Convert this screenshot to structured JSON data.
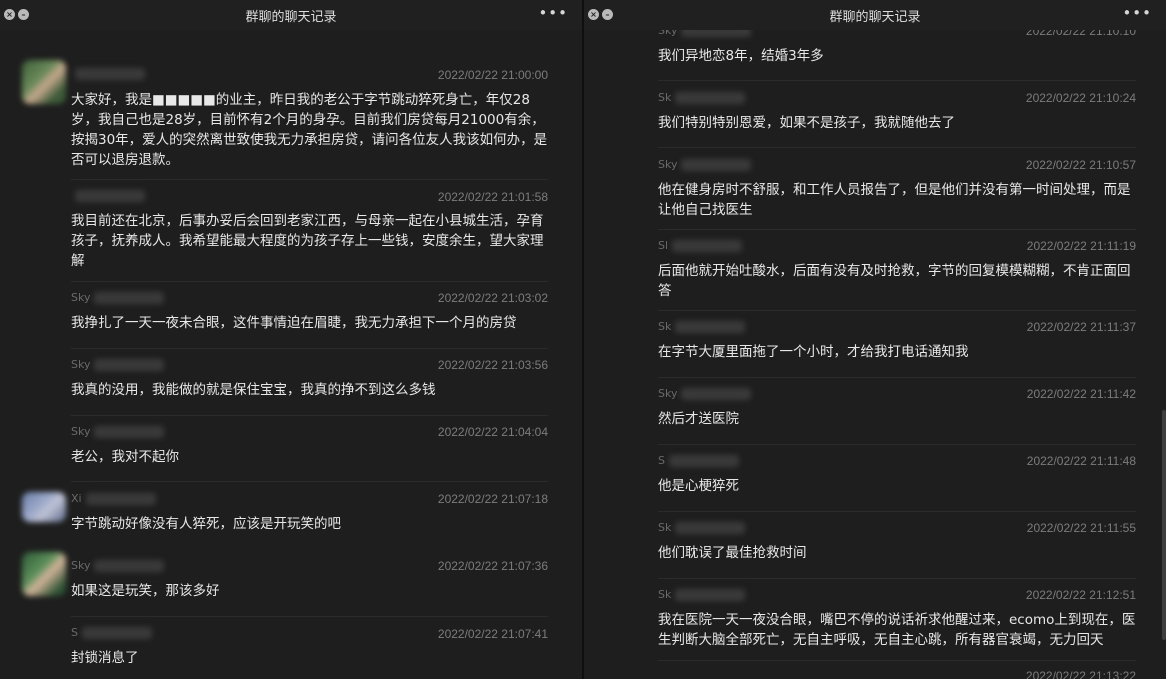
{
  "left": {
    "title": "群聊的聊天记录",
    "messages": [
      {
        "sender": "",
        "time": "2022/02/22 21:00:00",
        "text": "大家好，我是■■■■■的业主，昨日我的老公于字节跳动猝死身亡，年仅28岁，我自己也是28岁，目前怀有2个月的身孕。目前我们房贷每月21000有余，按揭30年，爱人的突然离世致使我无力承担房贷，请问各位友人我该如何办，是否可以退房退款。"
      },
      {
        "sender": "",
        "time": "2022/02/22 21:01:58",
        "text": "我目前还在北京，后事办妥后会回到老家江西，与母亲一起在小县城生活，孕育孩子，抚养成人。我希望能最大程度的为孩子存上一些钱，安度余生，望大家理解"
      },
      {
        "sender": "Sky",
        "time": "2022/02/22 21:03:02",
        "text": "我挣扎了一天一夜未合眼，这件事情迫在眉睫，我无力承担下一个月的房贷"
      },
      {
        "sender": "Sky",
        "time": "2022/02/22 21:03:56",
        "text": "我真的没用，我能做的就是保住宝宝，我真的挣不到这么多钱"
      },
      {
        "sender": "Sky",
        "time": "2022/02/22 21:04:04",
        "text": "老公，我对不起你"
      },
      {
        "sender": "Xi",
        "time": "2022/02/22 21:07:18",
        "text": "字节跳动好像没有人猝死，应该是开玩笑的吧"
      },
      {
        "sender": "Sky",
        "time": "2022/02/22 21:07:36",
        "text": "如果这是玩笑，那该多好"
      },
      {
        "sender": "S",
        "time": "2022/02/22 21:07:41",
        "text": "封锁消息了"
      }
    ]
  },
  "right": {
    "title": "群聊的聊天记录",
    "messages": [
      {
        "sender": "Sky",
        "time": "2022/02/22 21:10:10",
        "text": "我们异地恋8年，结婚3年多"
      },
      {
        "sender": "Sk",
        "time": "2022/02/22 21:10:24",
        "text": "我们特别特别恩爱，如果不是孩子，我就随他去了"
      },
      {
        "sender": "Sky",
        "time": "2022/02/22 21:10:57",
        "text": "他在健身房时不舒服，和工作人员报告了，但是他们并没有第一时间处理，而是让他自己找医生"
      },
      {
        "sender": "Sl",
        "time": "2022/02/22 21:11:19",
        "text": "后面他就开始吐酸水，后面有没有及时抢救，字节的回复模模糊糊，不肯正面回答"
      },
      {
        "sender": "Sk",
        "time": "2022/02/22 21:11:37",
        "text": "在字节大厦里面拖了一个小时，才给我打电话通知我"
      },
      {
        "sender": "Sky",
        "time": "2022/02/22 21:11:42",
        "text": "然后才送医院"
      },
      {
        "sender": "S",
        "time": "2022/02/22 21:11:48",
        "text": "他是心梗猝死"
      },
      {
        "sender": "Sk",
        "time": "2022/02/22 21:11:55",
        "text": "他们耽误了最佳抢救时间"
      },
      {
        "sender": "Sk",
        "time": "2022/02/22 21:12:51",
        "text": "我在医院一天一夜没合眼，嘴巴不停的说话祈求他醒过来，ecomo上到现在，医生判断大脑全部死亡，无自主呼吸，无自主心跳，所有器官衰竭，无力回天"
      },
      {
        "sender": "",
        "time": "2022/02/22 21:13:22",
        "text": ""
      }
    ]
  }
}
